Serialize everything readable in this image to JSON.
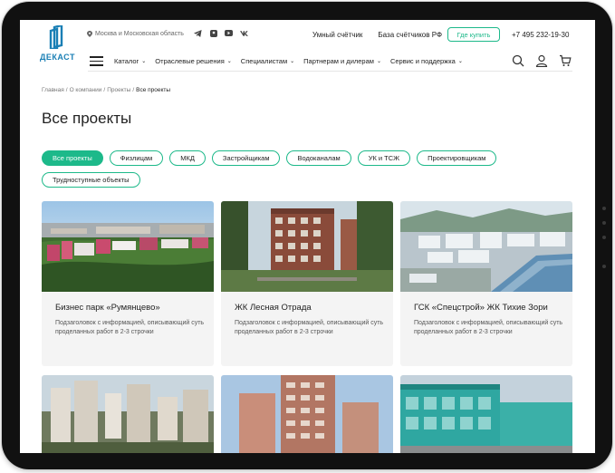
{
  "header": {
    "logo_text": "ДЕКАСТ",
    "location": "Москва и Московская область",
    "socials": [
      "telegram-icon",
      "ok-icon",
      "youtube-icon",
      "vk-icon"
    ],
    "social_glyphs": [
      "✈",
      "●",
      "▶",
      "vk"
    ],
    "links": [
      "Умный счётчик",
      "База счётчиков РФ"
    ],
    "where_buy": "Где купить",
    "phone": "+7 495 232-19-30"
  },
  "nav": {
    "items": [
      {
        "label": "Каталог"
      },
      {
        "label": "Отраслевые решения"
      },
      {
        "label": "Специалистам"
      },
      {
        "label": "Партнерам и дилерам"
      },
      {
        "label": "Сервис и поддержка"
      }
    ]
  },
  "breadcrumb": {
    "items": [
      "Главная",
      "О компании",
      "Проекты"
    ],
    "separator": "/",
    "current": "Все проекты"
  },
  "page_title": "Все проекты",
  "filters": [
    {
      "label": "Все проекты",
      "active": true
    },
    {
      "label": "Физлицам",
      "active": false
    },
    {
      "label": "МКД",
      "active": false
    },
    {
      "label": "Застройщикам",
      "active": false
    },
    {
      "label": "Водоканалам",
      "active": false
    },
    {
      "label": "УК и ТСЖ",
      "active": false
    },
    {
      "label": "Проектировщикам",
      "active": false
    },
    {
      "label": "Трудноступные объекты",
      "active": false
    }
  ],
  "projects": [
    {
      "title": "Бизнес парк «Румянцево»",
      "subtitle": "Подзаголовок с информацией, описывающий суть проделанных работ в 2-3 строчки"
    },
    {
      "title": "ЖК Лесная Отрада",
      "subtitle": "Подзаголовок с информацией, описывающий суть проделанных работ в 2-3 строчки"
    },
    {
      "title": "ГСК «Спецстрой» ЖК Тихие Зори",
      "subtitle": "Подзаголовок с информацией, описывающий суть проделанных работ в 2-3 строчки"
    }
  ],
  "colors": {
    "accent": "#1db98a",
    "logo": "#1a7fb5"
  }
}
